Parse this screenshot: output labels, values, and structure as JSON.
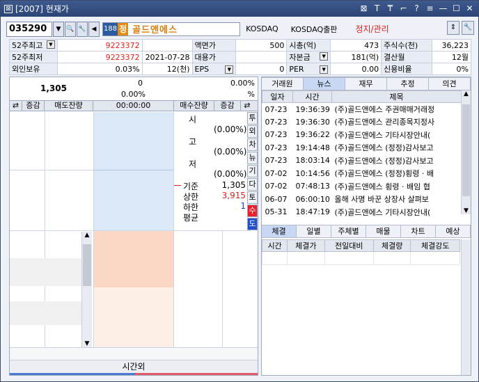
{
  "window": {
    "title": "[2007] 현재가"
  },
  "toolbar": {
    "code": "035290",
    "badge1": "188",
    "badge2": "정",
    "stock_name": "골드앤에스",
    "market": "KOSDAQ",
    "board": "KOSDAQ출판",
    "warning": "정지/관리"
  },
  "info": {
    "r1": [
      "52주최고",
      "9223372",
      "액면가",
      "500",
      "시총(억)",
      "473",
      "주식수(천)",
      "36,223"
    ],
    "r2": [
      "52주최저",
      "9223372",
      "2021-07-28",
      "대용가",
      "",
      "자본금",
      "181(억)",
      "결산월",
      "12월"
    ],
    "r3": [
      "외인보유",
      "0.03%",
      "12(천)",
      "EPS",
      "0",
      "PER",
      "0.00",
      "신용비율",
      "0%"
    ]
  },
  "orderbook": {
    "price": "1,305",
    "zero1": "0",
    "zero2": "0.00%",
    "pct1": "0.00%",
    "pct_sign": "%",
    "headers": [
      "증감",
      "매도잔량",
      "00:00:00",
      "매수잔량",
      "증감"
    ],
    "side_labels": [
      "시",
      "고",
      "저"
    ],
    "side_pcts": [
      "(0.00%)",
      "(0.00%)",
      "(0.00%)"
    ],
    "vtabs": [
      "투",
      "외",
      "차",
      "뉴",
      "기",
      "다",
      "토",
      "수",
      "도"
    ],
    "stats": [
      {
        "label": "기준",
        "value": "1,305",
        "color": "#000"
      },
      {
        "label": "상한",
        "value": "3,915",
        "color": "#e0201a"
      },
      {
        "label": "하한",
        "value": "1",
        "color": "#1a3ed0"
      },
      {
        "label": "평균",
        "value": "",
        "color": "#000"
      }
    ],
    "after_hours": "시간외"
  },
  "news": {
    "tabs": [
      "거래원",
      "뉴스",
      "재무",
      "추정",
      "의견"
    ],
    "active_tab": 1,
    "headers": [
      "일자",
      "시간",
      "제목"
    ],
    "rows": [
      [
        "07-23",
        "19:36:39",
        "(주)골드앤에스 주권매매거래정"
      ],
      [
        "07-23",
        "19:36:30",
        "(주)골드앤에스 관리종목지정사"
      ],
      [
        "07-23",
        "19:36:22",
        "(주)골드앤에스 기타시장안내("
      ],
      [
        "07-23",
        "19:14:48",
        "(주)골드앤에스 (정정)감사보고"
      ],
      [
        "07-23",
        "18:03:14",
        "(주)골드앤에스 (정정)감사보고"
      ],
      [
        "07-02",
        "10:14:56",
        "(주)골드앤에스 (정정)횡령 · 배"
      ],
      [
        "07-02",
        "07:48:13",
        "(주)골드앤에스 횡령 · 배임 협"
      ],
      [
        "06-07",
        "06:00:10",
        "올해 사명 바꾼 상장사 살펴보"
      ],
      [
        "05-31",
        "18:47:19",
        "(주)골드앤에스 기타시장안내("
      ]
    ]
  },
  "trades": {
    "tabs": [
      "체결",
      "일별",
      "주체별",
      "매물",
      "차트",
      "예상"
    ],
    "active_tab": 0,
    "headers": [
      "시간",
      "체결가",
      "전일대비",
      "체결량",
      "체결강도"
    ]
  }
}
